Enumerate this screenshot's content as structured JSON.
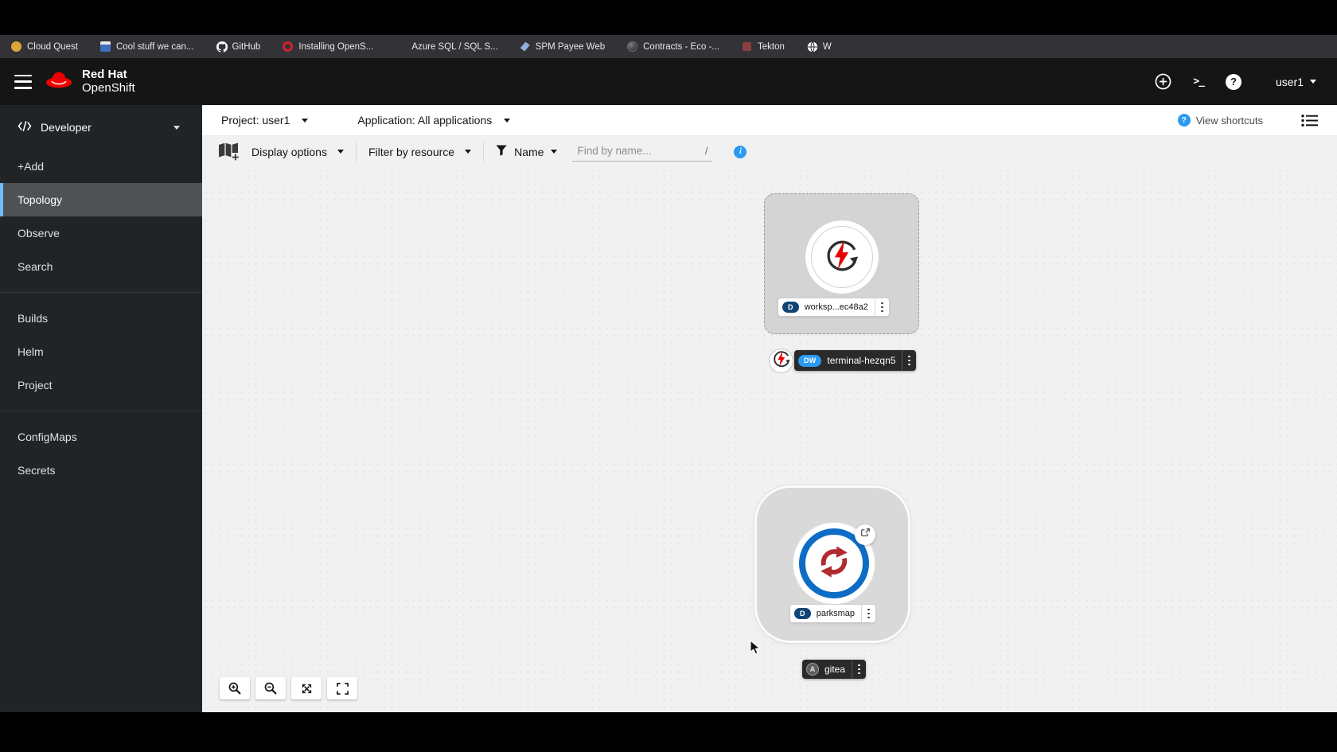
{
  "bookmarks": {
    "items": [
      {
        "label": "Cloud Quest",
        "icon": "cloud-quest"
      },
      {
        "label": "Cool stuff we can...",
        "icon": "window"
      },
      {
        "label": "GitHub",
        "icon": "github"
      },
      {
        "label": "Installing OpenS...",
        "icon": "openshift"
      },
      {
        "label": "Azure SQL / SQL S...",
        "icon": "microsoft"
      },
      {
        "label": "SPM Payee Web",
        "icon": "wing"
      },
      {
        "label": "Contracts - Eco -...",
        "icon": "globe-dark"
      },
      {
        "label": "Tekton",
        "icon": "tekton"
      },
      {
        "label": "W",
        "icon": "globe"
      }
    ]
  },
  "masthead": {
    "brand_line1": "Red Hat",
    "brand_line2": "OpenShift",
    "user": "user1"
  },
  "sidebar": {
    "perspective": "Developer",
    "items": [
      {
        "label": "+Add",
        "active": false
      },
      {
        "label": "Topology",
        "active": true
      },
      {
        "label": "Observe",
        "active": false
      },
      {
        "label": "Search",
        "active": false
      },
      {
        "label": "Builds",
        "active": false
      },
      {
        "label": "Helm",
        "active": false
      },
      {
        "label": "Project",
        "active": false
      },
      {
        "label": "ConfigMaps",
        "active": false
      },
      {
        "label": "Secrets",
        "active": false
      }
    ]
  },
  "context_bar": {
    "project_label": "Project: user1",
    "application_label": "Application: All applications",
    "view_shortcuts": "View shortcuts"
  },
  "filter_bar": {
    "display_options": "Display options",
    "filter_by_resource": "Filter by resource",
    "name_filter": "Name",
    "search_placeholder": "Find by name...",
    "shortcut_hint": "/"
  },
  "topology": {
    "workspace_node": {
      "badge": "D",
      "label": "worksp...ec48a2"
    },
    "terminal_node": {
      "badge": "DW",
      "label": "terminal-hezqn5"
    },
    "parksmap_node": {
      "badge": "D",
      "label": "parksmap"
    },
    "gitea_node": {
      "badge": "A",
      "label": "gitea"
    }
  },
  "colors": {
    "brand_red": "#ee0000",
    "accent_blue": "#2b9af3",
    "active_item_border": "#73bcf7",
    "badge_navy": "#0e4575",
    "badge_gray": "#5c5e60",
    "node_ring_blue": "#0d6dc6",
    "masthead_bg": "#151515",
    "sidebar_bg": "#212427",
    "canvas_bg": "#f1f1f1"
  }
}
